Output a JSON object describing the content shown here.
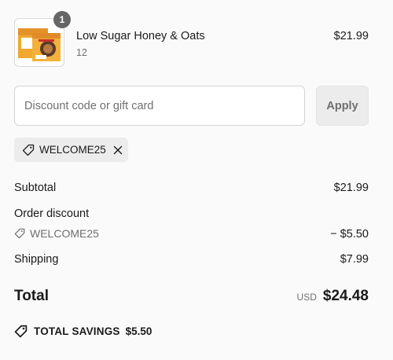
{
  "product": {
    "name": "Low Sugar Honey & Oats",
    "variant": "12",
    "price": "$21.99",
    "quantity_badge": "1",
    "image_icon": "product-box-image"
  },
  "discount": {
    "placeholder": "Discount code or gift card",
    "value": "",
    "apply_label": "Apply",
    "applied_code": "WELCOME25"
  },
  "summary": {
    "subtotal_label": "Subtotal",
    "subtotal_value": "$21.99",
    "order_discount_label": "Order discount",
    "discount_code": "WELCOME25",
    "discount_value": "− $5.50",
    "shipping_label": "Shipping",
    "shipping_value": "$7.99",
    "total_label": "Total",
    "currency": "USD",
    "total_value": "$24.48",
    "savings_label": "TOTAL SAVINGS",
    "savings_value": "$5.50"
  },
  "colors": {
    "badge": "#666666",
    "muted_text": "#707070",
    "chip_bg": "#ececec",
    "page_bg": "#fafafa"
  }
}
